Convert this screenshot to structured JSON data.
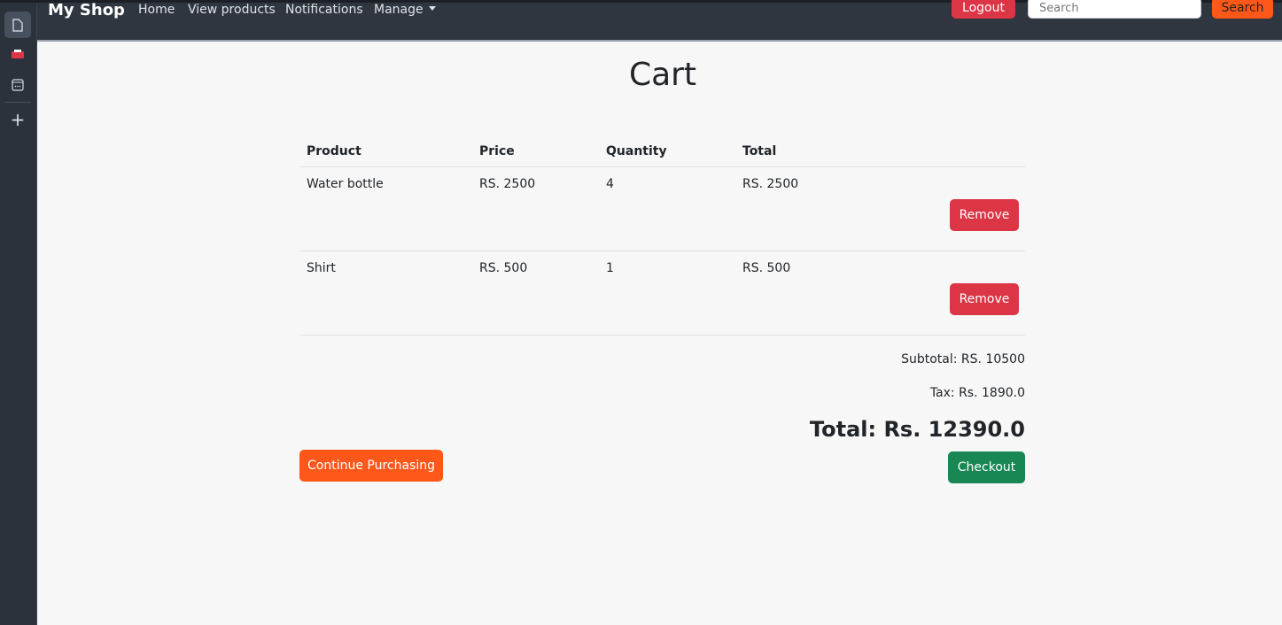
{
  "sidebar": {
    "items": [
      {
        "icon": "document-icon"
      },
      {
        "icon": "pdf-icon"
      },
      {
        "icon": "window-icon"
      },
      {
        "icon": "plus-icon"
      }
    ]
  },
  "navbar": {
    "brand": "My Shop",
    "links": [
      "Home",
      "View products",
      "Notifications",
      "Manage"
    ],
    "logout": "Logout",
    "search_placeholder": "Search",
    "search_button": "Search"
  },
  "page": {
    "title": "Cart"
  },
  "table": {
    "headers": [
      "Product",
      "Price",
      "Quantity",
      "Total"
    ],
    "rows": [
      {
        "product": "Water bottle",
        "price": "RS. 2500",
        "quantity": "4",
        "total": "RS. 2500",
        "action": "Remove"
      },
      {
        "product": "Shirt",
        "price": "RS. 500",
        "quantity": "1",
        "total": "RS. 500",
        "action": "Remove"
      }
    ]
  },
  "summary": {
    "subtotal": "Subtotal: RS. 10500",
    "tax": "Tax: Rs. 1890.0",
    "total": "Total: Rs. 12390.0"
  },
  "actions": {
    "continue": "Continue Purchasing",
    "checkout": "Checkout"
  },
  "colors": {
    "danger": "#dc3545",
    "orange": "#fd5819",
    "success": "#198754",
    "navbar": "#2f3640"
  }
}
